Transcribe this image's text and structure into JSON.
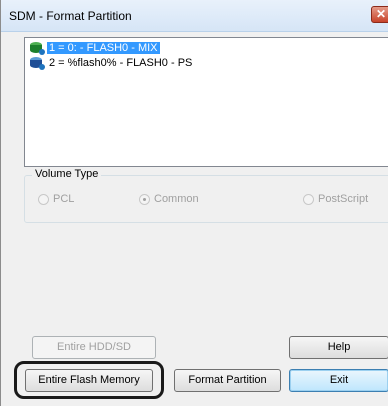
{
  "window": {
    "title": "SDM - Format Partition",
    "close_label": "✕"
  },
  "partitions": [
    {
      "label": "1 = 0: - FLASH0 - MIX",
      "selected": true,
      "icon": "green-drive-icon"
    },
    {
      "label": "2 = %flash0% - FLASH0 - PS",
      "selected": false,
      "icon": "blue-drive-icon"
    }
  ],
  "volume_type": {
    "label": "Volume Type",
    "options": [
      {
        "label": "PCL",
        "checked": false
      },
      {
        "label": "Common",
        "checked": true
      },
      {
        "label": "PostScript",
        "checked": false
      }
    ]
  },
  "buttons": {
    "entire_hdd": "Entire HDD/SD",
    "help": "Help",
    "entire_flash": "Entire Flash Memory",
    "format_partition": "Format Partition",
    "exit": "Exit"
  }
}
